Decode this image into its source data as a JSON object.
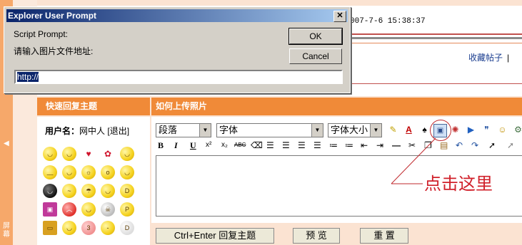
{
  "page": {
    "left_side_text": "屏幕",
    "post_info": "007-7-6 15:38:37",
    "favorite_link": "收藏帖子",
    "favorite_separator": "|"
  },
  "quick_reply": {
    "title": "快速回复主题",
    "username_label": "用户名：",
    "username": "网中人",
    "logout": "[退出]",
    "smilies": [
      "smile",
      "grin",
      "heart",
      "rose",
      "happy",
      "cry",
      "blush",
      "sun",
      "wow",
      "wink",
      "devil",
      "confused",
      "rain",
      "cool",
      "laugh",
      "gift",
      "angry",
      "sunglasses",
      "skull",
      "tongue",
      "tv",
      "shy",
      "kiss",
      "sleepy",
      "laugh-big"
    ]
  },
  "editor": {
    "subject": "如何上传照片",
    "paragraph_select": "段落",
    "font_select": "字体",
    "size_select": "字体大小",
    "bold": "B",
    "italic": "I",
    "underline": "U",
    "superscript": "x²",
    "subscript": "x₂",
    "strikethrough": "ABC"
  },
  "buttons": {
    "submit": "Ctrl+Enter 回复主题",
    "preview": "预 览",
    "reset": "重 置"
  },
  "annotation": {
    "text": "点击这里",
    "color": "#d0202a"
  },
  "dialog": {
    "title": "Explorer User Prompt",
    "script_prompt": "Script Prompt:",
    "message": "请输入图片文件地址:",
    "ok": "OK",
    "cancel": "Cancel",
    "input_value": "http://",
    "close": "✕"
  },
  "colors": {
    "header_orange": "#f08a38",
    "panel_peach": "#fbe3d2",
    "titlebar_blue": "#0a246a"
  }
}
